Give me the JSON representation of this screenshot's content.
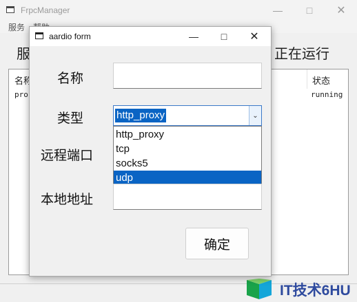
{
  "main_window": {
    "title": "FrpcManager",
    "menu": [
      "服务",
      "帮助"
    ],
    "heading_left": "服",
    "heading_right": "正在运行",
    "list": {
      "col_name": "名称",
      "col_status": "状态",
      "row_name": "pro",
      "row_status": "running"
    }
  },
  "dialog": {
    "title": "aardio form",
    "labels": {
      "name": "名称",
      "type": "类型",
      "remote_port": "远程端口",
      "local_addr": "本地地址"
    },
    "name_value": "",
    "type_selected": "http_proxy",
    "type_options": [
      "http_proxy",
      "tcp",
      "socks5",
      "udp"
    ],
    "highlighted_option": "udp",
    "confirm_label": "确定"
  },
  "watermark": {
    "text": "IT技术6HU"
  },
  "colors": {
    "selection": "#0a64c4",
    "focus_border": "#3a78c8",
    "watermark": "#2e4a9e"
  }
}
